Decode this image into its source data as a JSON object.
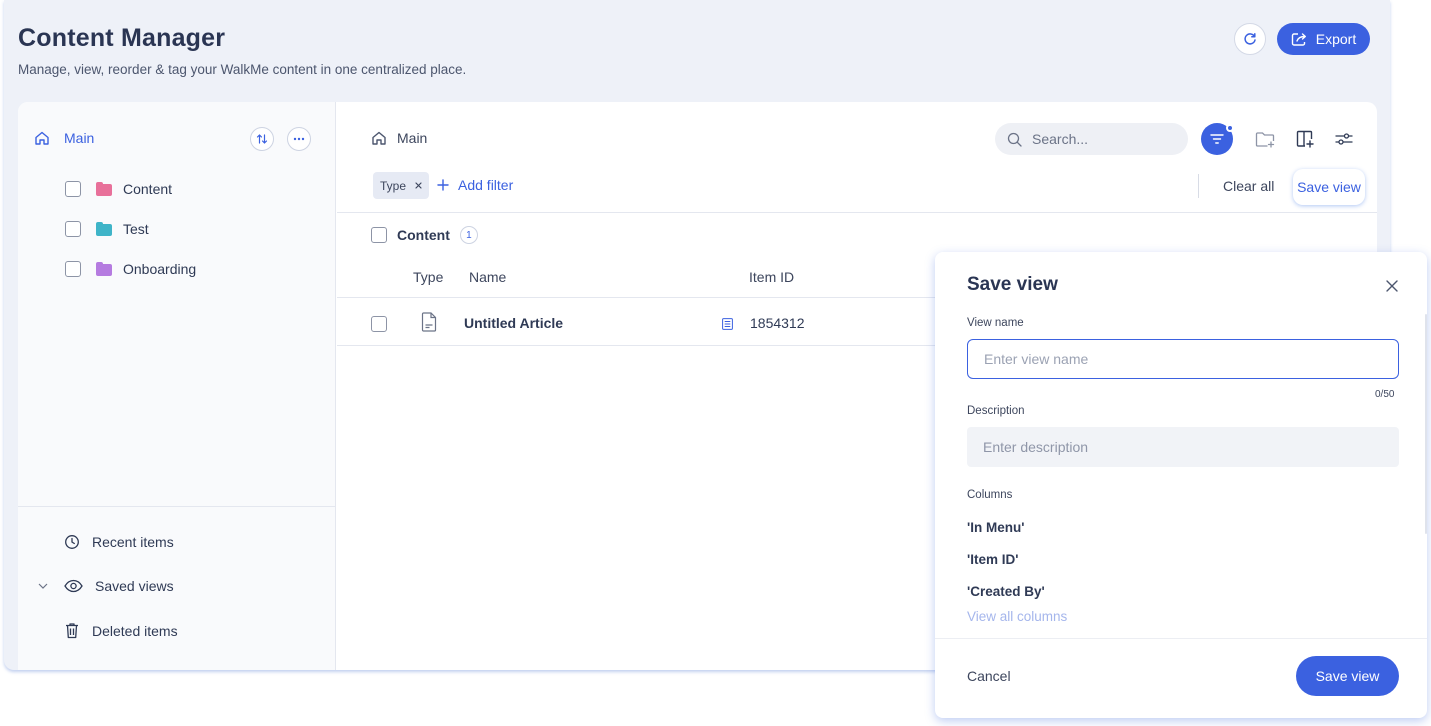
{
  "header": {
    "title": "Content Manager",
    "subtitle": "Manage, view, reorder & tag your WalkMe content in one centralized place.",
    "export_label": "Export"
  },
  "sidebar": {
    "root_label": "Main",
    "folders": [
      {
        "label": "Content",
        "color": "#e8709a"
      },
      {
        "label": "Test",
        "color": "#3fb4c8"
      },
      {
        "label": "Onboarding",
        "color": "#b57be0"
      }
    ],
    "bottom_items": [
      {
        "label": "Recent items",
        "icon": "clock-icon"
      },
      {
        "label": "Saved views",
        "icon": "eye-icon"
      },
      {
        "label": "Deleted items",
        "icon": "trash-icon"
      }
    ]
  },
  "main": {
    "breadcrumb": "Main",
    "search_placeholder": "Search...",
    "filter_chip": "Type",
    "add_filter_label": "Add filter",
    "clear_all_label": "Clear all",
    "save_view_label": "Save view",
    "group": {
      "label": "Content",
      "count": "1"
    },
    "columns": [
      "Type",
      "Name",
      "Item ID"
    ],
    "rows": [
      {
        "type_icon": "article-icon",
        "name": "Untitled Article",
        "item_id": "1854312"
      }
    ]
  },
  "dialog": {
    "title": "Save view",
    "view_name_label": "View name",
    "view_name_placeholder": "Enter view name",
    "counter": "0/50",
    "description_label": "Description",
    "description_placeholder": "Enter description",
    "columns_label": "Columns",
    "columns": [
      "'In Menu'",
      "'Item ID'",
      "'Created By'"
    ],
    "view_all_label": "View all columns",
    "cancel_label": "Cancel",
    "save_label": "Save view"
  },
  "colors": {
    "accent": "#3b61e0",
    "background": "#eef1f8"
  }
}
